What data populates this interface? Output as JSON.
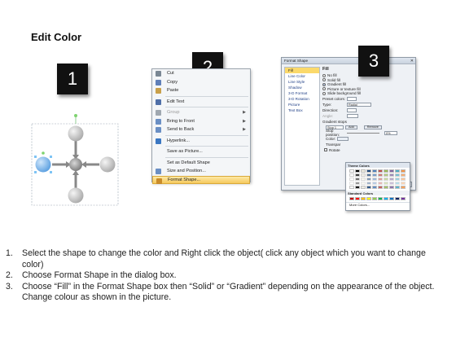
{
  "slide": {
    "title": "Edit Color"
  },
  "badges": [
    "1",
    "2",
    "3"
  ],
  "context_menu": {
    "items": [
      {
        "label": "Cut",
        "icon": "scissors-icon",
        "color": "#7a8794"
      },
      {
        "label": "Copy",
        "icon": "copy-icon",
        "color": "#5f7fb8"
      },
      {
        "label": "Paste",
        "icon": "paste-icon",
        "color": "#c9a04a"
      },
      {
        "label": "Edit Text",
        "icon": "edit-text-icon",
        "color": "#4f6fa8"
      },
      {
        "label": "Group",
        "icon": "group-icon",
        "color": "#a0a8b0"
      },
      {
        "label": "Bring to Front",
        "icon": "bring-front-icon",
        "color": "#6a8fc4"
      },
      {
        "label": "Send to Back",
        "icon": "send-back-icon",
        "color": "#6a8fc4"
      },
      {
        "label": "Hyperlink...",
        "icon": "hyperlink-icon",
        "color": "#3a77c2"
      },
      {
        "label": "Save as Picture...",
        "icon": "",
        "color": ""
      },
      {
        "label": "Set as Default Shape",
        "icon": "",
        "color": ""
      },
      {
        "label": "Size and Position...",
        "icon": "size-icon",
        "color": "#6a8fc4"
      },
      {
        "label": "Format Shape...",
        "icon": "format-shape-icon",
        "color": "#c98b2a"
      }
    ]
  },
  "dialog": {
    "title": "Format Shape",
    "nav": [
      "Fill",
      "Line Color",
      "Line Style",
      "Shadow",
      "3-D Format",
      "3-D Rotation",
      "Picture",
      "Text Box"
    ],
    "heading": "Fill",
    "fill_options": [
      "No fill",
      "Solid fill",
      "Gradient fill",
      "Picture or texture fill",
      "Slide background fill"
    ],
    "fields": {
      "preset_colors": "Preset colors:",
      "type": "Type:",
      "type_value": "Radial",
      "direction": "Direction:",
      "angle": "Angle:",
      "gradient_stops": "Gradient stops",
      "stop_value": "Stop 1",
      "add": "Add",
      "remove": "Remove",
      "stop_position": "Stop position:",
      "stop_position_value": "0%",
      "color": "Color:",
      "transparency": "Transpar",
      "rotate": "Rotate"
    },
    "close": "Close"
  },
  "palette": {
    "theme_label": "Theme Colors",
    "standard_label": "Standard Colors",
    "more": "More Colors...",
    "theme_row": [
      "#ffffff",
      "#000000",
      "#eeece1",
      "#1f497d",
      "#4f81bd",
      "#c0504d",
      "#9bbb59",
      "#8064a2",
      "#4bacc6",
      "#f79646"
    ],
    "standard_row": [
      "#c00000",
      "#ff0000",
      "#ffc000",
      "#ffff00",
      "#92d050",
      "#00b050",
      "#00b0f0",
      "#0070c0",
      "#002060",
      "#7030a0"
    ]
  },
  "instructions": [
    {
      "num": "1.",
      "text": "Select the shape to change the color and Right click the object( click any object which you want to change color)"
    },
    {
      "num": "2.",
      "text": "Choose Format Shape in the dialog box."
    },
    {
      "num": "3.",
      "text": "Choose “Fill” in the Format Shape box then “Solid” or “Gradient” depending on the appearance of the object. Change colour as shown in the picture."
    }
  ],
  "colors": {
    "selected_shape": "#6aaee8",
    "gray_shape": "#c8c8c8",
    "highlight": "#f6c95c"
  }
}
